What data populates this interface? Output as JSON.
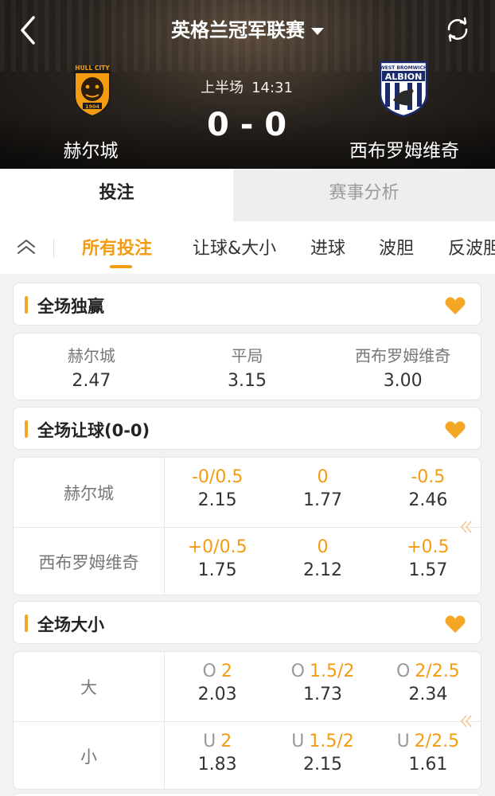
{
  "header": {
    "league_title": "英格兰冠军联赛",
    "status": "上半场",
    "clock": "14:31",
    "score": "0 - 0",
    "home_team": "赫尔城",
    "away_team": "西布罗姆维奇",
    "home_logo_text": "HULL CITY",
    "home_logo_year": "1904",
    "away_logo_text_top": "WEST BROMWICH",
    "away_logo_text": "ALBION"
  },
  "main_tabs": [
    "投注",
    "赛事分析"
  ],
  "sub_tabs": [
    "所有投注",
    "让球&大小",
    "进球",
    "波胆",
    "反波胆"
  ],
  "sections": {
    "match_winner": {
      "title": "全场独赢",
      "outcomes": [
        {
          "name": "赫尔城",
          "odd": "2.47"
        },
        {
          "name": "平局",
          "odd": "3.15"
        },
        {
          "name": "西布罗姆维奇",
          "odd": "3.00"
        }
      ]
    },
    "handicap": {
      "title": "全场让球(0-0)",
      "rows": [
        {
          "label": "赫尔城",
          "cells": [
            {
              "line": "-0/0.5",
              "odd": "2.15"
            },
            {
              "line": "0",
              "odd": "1.77"
            },
            {
              "line": "-0.5",
              "odd": "2.46"
            }
          ]
        },
        {
          "label": "西布罗姆维奇",
          "cells": [
            {
              "line": "+0/0.5",
              "odd": "1.75"
            },
            {
              "line": "0",
              "odd": "2.12"
            },
            {
              "line": "+0.5",
              "odd": "1.57"
            }
          ]
        }
      ]
    },
    "over_under": {
      "title": "全场大小",
      "rows": [
        {
          "label": "大",
          "cells": [
            {
              "prefix": "O",
              "line": "2",
              "odd": "2.03"
            },
            {
              "prefix": "O",
              "line": "1.5/2",
              "odd": "1.73"
            },
            {
              "prefix": "O",
              "line": "2/2.5",
              "odd": "2.34"
            }
          ]
        },
        {
          "label": "小",
          "cells": [
            {
              "prefix": "U",
              "line": "2",
              "odd": "1.83"
            },
            {
              "prefix": "U",
              "line": "1.5/2",
              "odd": "2.15"
            },
            {
              "prefix": "U",
              "line": "2/2.5",
              "odd": "1.61"
            }
          ]
        }
      ]
    }
  },
  "colors": {
    "accent": "#f39c12",
    "favorite": "#f5a623",
    "muted_text": "#777777"
  },
  "icons": {
    "back": "chevron-left-icon",
    "dropdown": "caret-down-icon",
    "refresh": "refresh-icon",
    "collapse": "double-chevron-up-icon",
    "favorite": "heart-icon",
    "more": "double-chevron-left-icon"
  }
}
